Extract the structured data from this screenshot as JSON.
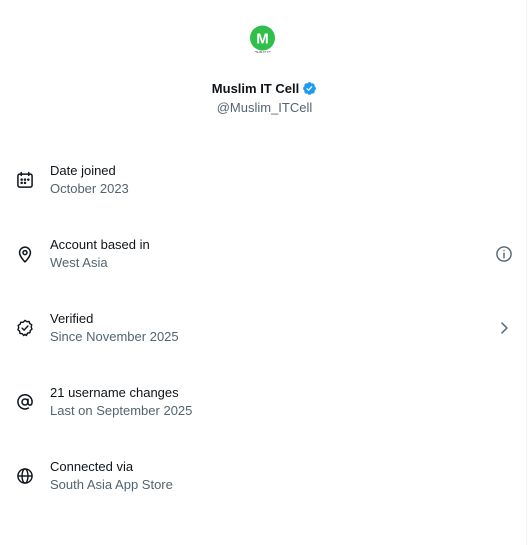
{
  "profile": {
    "avatar_letter": "M",
    "avatar_caption": "MUSLIM IT CELL",
    "avatar_color": "#2fbf4a",
    "display_name": "Muslim IT Cell",
    "handle": "@Muslim_ITCell",
    "verified_badge_color": "#1d9bf0"
  },
  "rows": [
    {
      "icon": "calendar-icon",
      "title": "Date joined",
      "subtitle": "October 2023",
      "action": null
    },
    {
      "icon": "location-pin-icon",
      "title": "Account based in",
      "subtitle": "West Asia",
      "action": "info-icon"
    },
    {
      "icon": "verified-check-icon",
      "title": "Verified",
      "subtitle": "Since November 2025",
      "action": "chevron-right-icon"
    },
    {
      "icon": "at-sign-icon",
      "title": "21 username changes",
      "subtitle": "Last on September 2025",
      "action": null
    },
    {
      "icon": "globe-icon",
      "title": "Connected via",
      "subtitle": "South Asia App Store",
      "action": null
    }
  ],
  "colors": {
    "primary_text": "#0f1419",
    "secondary_text": "#536471",
    "background": "#ffffff"
  }
}
